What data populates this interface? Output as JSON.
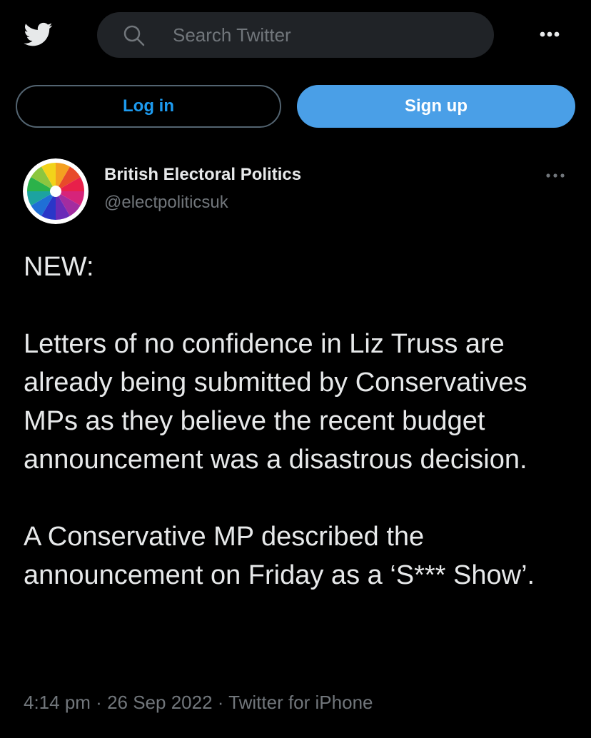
{
  "header": {
    "search_placeholder": "Search Twitter",
    "login_label": "Log in",
    "signup_label": "Sign up"
  },
  "tweet": {
    "author_name": "British Electoral Politics",
    "author_handle": "@electpoliticsuk",
    "text": "NEW:\n\nLetters of no confidence in Liz Truss are already being submitted by Conservatives MPs as they believe the recent budget announcement was a disastrous decision.\n\nA Conservative MP described the announcement on Friday as a ‘S*** Show’.",
    "time": "4:14 pm",
    "separator": " · ",
    "date": "26 Sep 2022",
    "source": "Twitter for iPhone"
  },
  "icons": {
    "logo": "twitter-bird-icon",
    "search": "search-icon",
    "more": "more-dots-icon"
  },
  "colors": {
    "background": "#000000",
    "primary_text": "#e7e9ea",
    "secondary_text": "#71767b",
    "accent": "#1d9bf0",
    "signup_bg": "#4a9fe7",
    "search_bg": "#202327"
  }
}
